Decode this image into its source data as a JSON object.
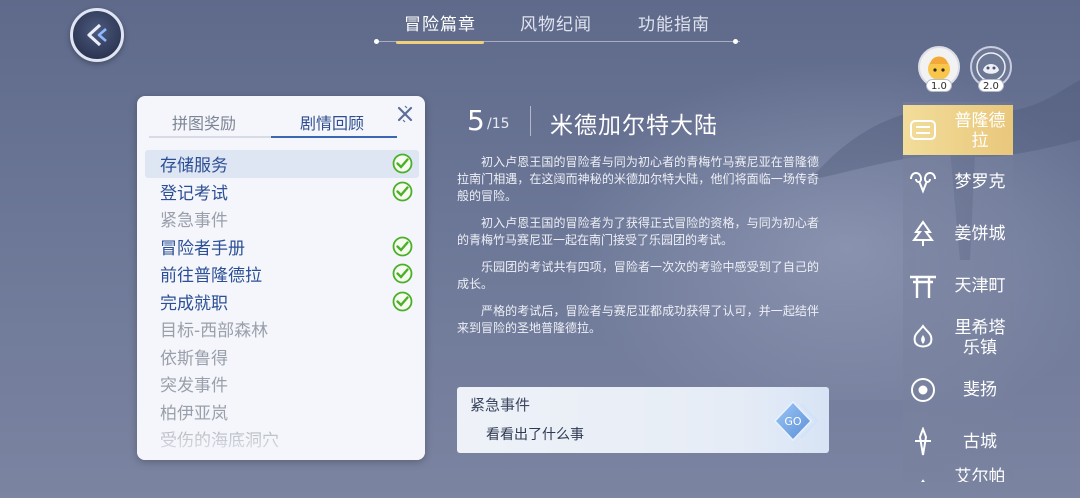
{
  "nav": {
    "tabs": [
      {
        "label": "冒险篇章",
        "active": true
      },
      {
        "label": "风物纪闻",
        "active": false
      },
      {
        "label": "功能指南",
        "active": false
      }
    ],
    "back_icon": "back-arrow-icon"
  },
  "panel": {
    "tabs": [
      {
        "label": "拼图奖励",
        "active": false
      },
      {
        "label": "剧情回顾",
        "active": true
      }
    ],
    "close_icon": "close-icon",
    "items": [
      {
        "label": "存储服务",
        "done": true
      },
      {
        "label": "登记考试",
        "done": true
      },
      {
        "label": "紧急事件",
        "done": false
      },
      {
        "label": "冒险者手册",
        "done": true
      },
      {
        "label": "前往普隆德拉",
        "done": true
      },
      {
        "label": "完成就职",
        "done": true
      },
      {
        "label": "目标-西部森林",
        "done": false
      },
      {
        "label": "依斯鲁得",
        "done": false
      },
      {
        "label": "突发事件",
        "done": false
      },
      {
        "label": "柏伊亚岚",
        "done": false
      },
      {
        "label": "受伤的海底洞穴",
        "done": false
      }
    ]
  },
  "chapter": {
    "current": "5",
    "total": "/15",
    "title": "米德加尔特大陆",
    "paragraphs": [
      "初入卢恩王国的冒险者与同为初心者的青梅竹马赛尼亚在普隆德拉南门相遇，在这阔而神秘的米德加尔特大陆，他们将面临一场传奇般的冒险。",
      "初入卢恩王国的冒险者为了获得正式冒险的资格，与同为初心者的青梅竹马赛尼亚一起在南门接受了乐园团的考试。",
      "乐园团的考试共有四项，冒险者一次次的考验中感受到了自己的成长。",
      "严格的考试后，冒险者与赛尼亚都成功获得了认可，并一起结伴来到冒险的圣地普隆德拉。"
    ]
  },
  "event": {
    "title": "紧急事件",
    "desc": "看看出了什么事",
    "go_label": "GO"
  },
  "avatars": [
    {
      "badge": "1.0",
      "icon": "character-avatar-icon"
    },
    {
      "badge": "2.0",
      "icon": "mascot-avatar-icon"
    }
  ],
  "regions": [
    {
      "name": "普隆德拉",
      "icon": "prontera-icon",
      "active": true
    },
    {
      "name": "梦罗克",
      "icon": "ram-horn-icon",
      "active": false
    },
    {
      "name": "姜饼城",
      "icon": "pine-tree-icon",
      "active": false
    },
    {
      "name": "天津町",
      "icon": "torii-gate-icon",
      "active": false
    },
    {
      "name": "里希塔乐镇",
      "icon": "flame-emblem-icon",
      "active": false
    },
    {
      "name": "斐扬",
      "icon": "eye-emblem-icon",
      "active": false
    },
    {
      "name": "古城",
      "icon": "spire-icon",
      "active": false
    },
    {
      "name": "艾尔帕",
      "icon": "partial-region-icon",
      "active": false
    }
  ],
  "colors": {
    "accent_gold": "#f1d07a",
    "active_blue": "#3a66b3",
    "done_text": "#2c4f96",
    "pending_text": "#9aa0ab",
    "check_green": "#4caf2a"
  }
}
